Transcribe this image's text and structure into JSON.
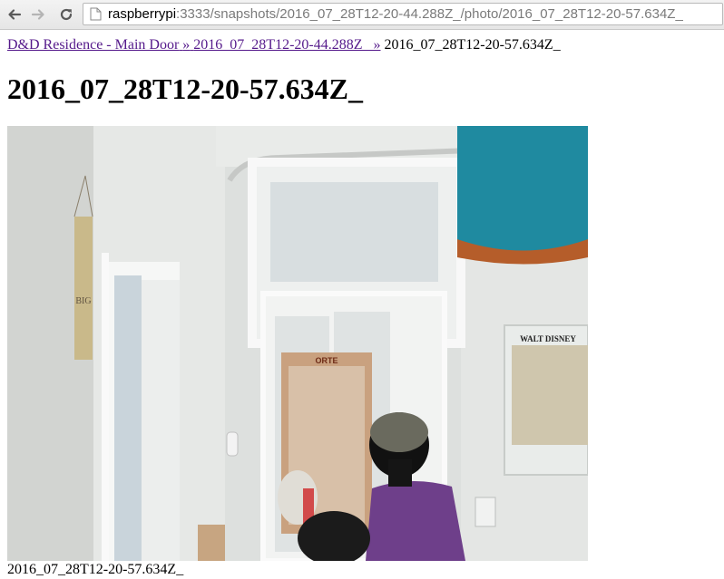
{
  "browser": {
    "url_host": "raspberrypi",
    "url_rest": ":3333/snapshots/2016_07_28T12-20-44.288Z_/photo/2016_07_28T12-20-57.634Z_"
  },
  "breadcrumb": {
    "items": [
      {
        "label": "D&D Residence - Main Door"
      },
      {
        "label": "2016_07_28T12-20-44.288Z_"
      }
    ],
    "separator": "»",
    "current": "2016_07_28T12-20-57.634Z_"
  },
  "page": {
    "title": "2016_07_28T12-20-57.634Z_"
  },
  "photo": {
    "poster_left_text": "ORTE",
    "poster_right_text": "WALT DISNEY",
    "sign_text": "BIG"
  },
  "caption": "2016_07_28T12-20-57.634Z_"
}
